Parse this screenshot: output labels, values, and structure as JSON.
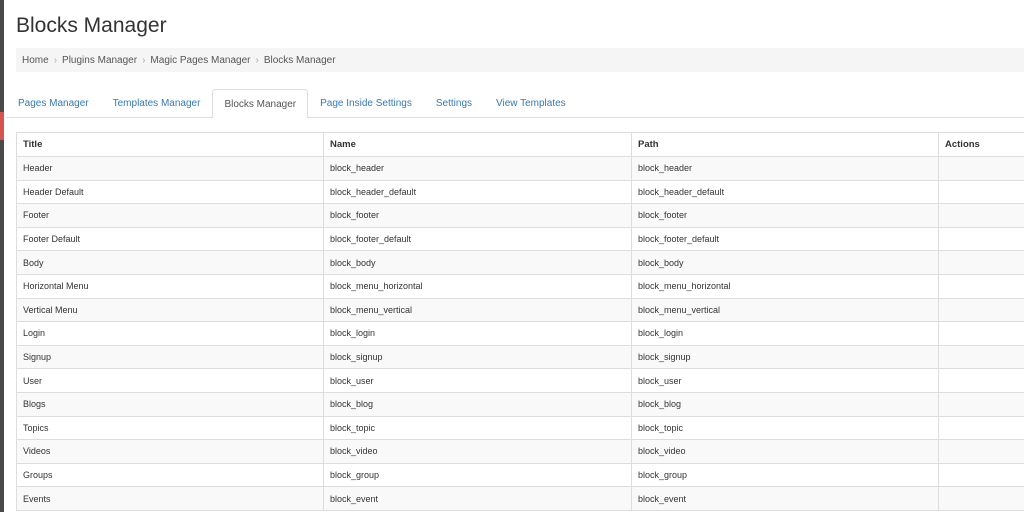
{
  "page": {
    "title": "Blocks Manager"
  },
  "breadcrumb": [
    "Home",
    "Plugins Manager",
    "Magic Pages Manager",
    "Blocks Manager"
  ],
  "breadcrumb_separator": "›",
  "tabs": [
    {
      "label": "Pages Manager",
      "active": false
    },
    {
      "label": "Templates Manager",
      "active": false
    },
    {
      "label": "Blocks Manager",
      "active": true
    },
    {
      "label": "Page Inside Settings",
      "active": false
    },
    {
      "label": "Settings",
      "active": false
    },
    {
      "label": "View Templates",
      "active": false
    }
  ],
  "table": {
    "headers": [
      "Title",
      "Name",
      "Path",
      "Actions"
    ],
    "rows": [
      {
        "title": "Header",
        "name": "block_header",
        "path": "block_header"
      },
      {
        "title": "Header Default",
        "name": "block_header_default",
        "path": "block_header_default"
      },
      {
        "title": "Footer",
        "name": "block_footer",
        "path": "block_footer"
      },
      {
        "title": "Footer Default",
        "name": "block_footer_default",
        "path": "block_footer_default"
      },
      {
        "title": "Body",
        "name": "block_body",
        "path": "block_body"
      },
      {
        "title": "Horizontal Menu",
        "name": "block_menu_horizontal",
        "path": "block_menu_horizontal"
      },
      {
        "title": "Vertical Menu",
        "name": "block_menu_vertical",
        "path": "block_menu_vertical"
      },
      {
        "title": "Login",
        "name": "block_login",
        "path": "block_login"
      },
      {
        "title": "Signup",
        "name": "block_signup",
        "path": "block_signup"
      },
      {
        "title": "User",
        "name": "block_user",
        "path": "block_user"
      },
      {
        "title": "Blogs",
        "name": "block_blog",
        "path": "block_blog"
      },
      {
        "title": "Topics",
        "name": "block_topic",
        "path": "block_topic"
      },
      {
        "title": "Videos",
        "name": "block_video",
        "path": "block_video"
      },
      {
        "title": "Groups",
        "name": "block_group",
        "path": "block_group"
      },
      {
        "title": "Events",
        "name": "block_event",
        "path": "block_event"
      }
    ]
  },
  "colors": {
    "link": "#337ab7",
    "breadcrumb_bg": "#f5f5f5",
    "row_stripe": "#f9f9f9",
    "border": "#dddddd",
    "rail": "#4a4a4a",
    "rail_accent": "#d9534f"
  }
}
